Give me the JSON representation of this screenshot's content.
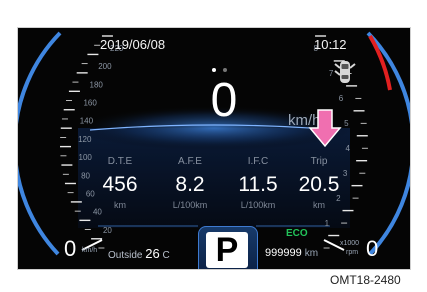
{
  "status": {
    "date": "2019/06/08",
    "time": "10:12"
  },
  "speed": {
    "value": "0",
    "unit": "km/h"
  },
  "trip_computer": [
    {
      "label": "D.T.E",
      "value": "456",
      "unit": "km"
    },
    {
      "label": "A.F.E",
      "value": "8.2",
      "unit": "L/100km"
    },
    {
      "label": "I.F.C",
      "value": "11.5",
      "unit": "L/100km"
    },
    {
      "label": "Trip",
      "value": "20.5",
      "unit": "km"
    }
  ],
  "speedometer": {
    "ticks": [
      "220",
      "200",
      "180",
      "160",
      "140",
      "120",
      "100",
      "80",
      "60",
      "40",
      "20"
    ],
    "zero": "0",
    "unit": "km/h"
  },
  "tachometer": {
    "ticks": [
      "8",
      "7",
      "6",
      "5",
      "4",
      "3",
      "2",
      "1"
    ],
    "zero": "0",
    "unit_top": "x1000",
    "unit_bottom": "rpm"
  },
  "outside_temp": {
    "label": "Outside",
    "value": "26",
    "unit": "C"
  },
  "gear": "P",
  "eco": "ECO",
  "odometer": {
    "value": "999999",
    "unit": "km"
  },
  "caption": "OMT18-2480",
  "colors": {
    "accent_blue": "#3f86e0",
    "redline": "#e22020",
    "eco_green": "#22c35a",
    "arrow_pink": "#f06fb0"
  },
  "icons": {
    "car": "car-doors-open-icon",
    "arrow": "down-arrow-icon"
  }
}
